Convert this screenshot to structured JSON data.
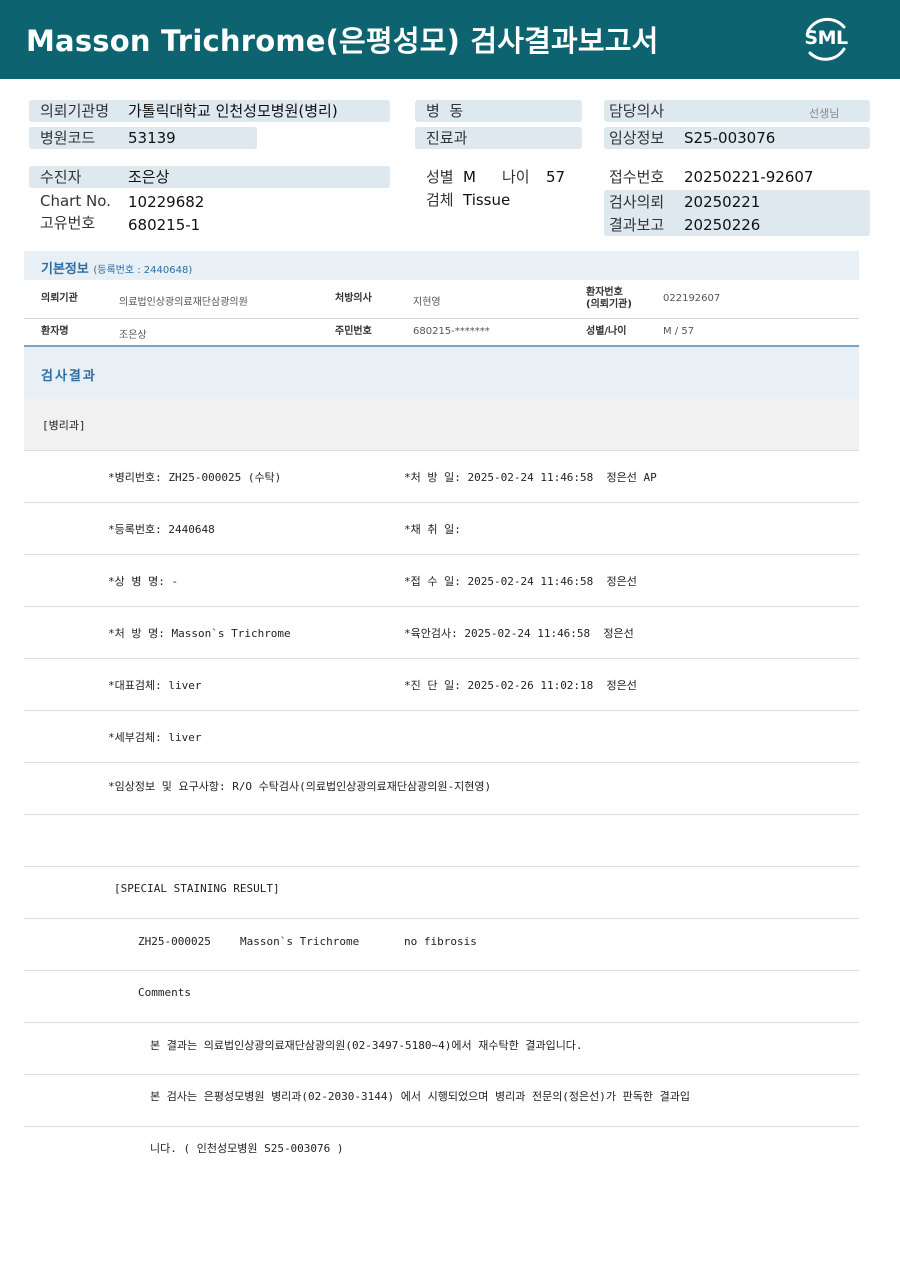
{
  "header": {
    "title": "Masson  Trichrome(은평성모) 검사결과보고서",
    "logo": "SML"
  },
  "top": {
    "req_org_label": "의뢰기관명",
    "req_org": "가톨릭대학교 인천성모병원(병리)",
    "hosp_code_label": "병원코드",
    "hosp_code": "53139",
    "ward_label": "병  동",
    "dept_label": "진료과",
    "doctor_label": "담당의사",
    "doctor_suffix": "선생님",
    "clinical_label": "임상정보",
    "clinical": "S25-003076",
    "patient_label": "수진자",
    "patient": "조은상",
    "chart_label": "Chart No.",
    "chart": "10229682",
    "unique_label": "고유번호",
    "unique": "680215-1",
    "sex_label": "성별",
    "sex": "M",
    "age_label": "나이",
    "age": "57",
    "specimen_label": "검체",
    "specimen": "Tissue",
    "receipt_label": "접수번호",
    "receipt": "20250221-92607",
    "request_label": "검사의뢰",
    "request": "20250221",
    "report_label": "결과보고",
    "report": "20250226"
  },
  "basic": {
    "title": "기본정보",
    "reg_note": "(등록번호 : 2440648)",
    "org_label": "의뢰기관",
    "org": "의료법인상광의료재단삼광의원",
    "presc_label": "처방의사",
    "presc": "지현영",
    "pno_label_1": "환자번호",
    "pno_label_2": "(의뢰기관)",
    "pno": "022192607",
    "name_label": "환자명",
    "name": "조은상",
    "rrn_label": "주민번호",
    "rrn": "680215-*******",
    "sexage_label": "성별/나이",
    "sexage": "M / 57"
  },
  "results": {
    "title": "검사결과",
    "dept": "[병리과]",
    "rows": [
      {
        "left": "*병리번호: ZH25-000025 (수탁)",
        "right": "*처 방 일: 2025-02-24 11:46:58  정은선 AP"
      },
      {
        "left": "*등록번호: 2440648",
        "right": "*채 취 일:"
      },
      {
        "left": "*상 병 명: -",
        "right": "*접 수 일: 2025-02-24 11:46:58  정은선"
      },
      {
        "left": "*처 방 명: Masson`s Trichrome",
        "right": "*육안검사: 2025-02-24 11:46:58  정은선"
      },
      {
        "left": "*대표검체: liver",
        "right": "*진 단 일: 2025-02-26 11:02:18  정은선"
      },
      {
        "left": "*세부검체: liver",
        "right": ""
      },
      {
        "left": "*임상정보 및 요구사항: R/O 수탁검사(의료법인상광의료재단삼광의원-지현영)",
        "right": ""
      }
    ],
    "special_title": "[SPECIAL STAINING RESULT]",
    "special_id": "ZH25-000025",
    "special_test": "Masson`s Trichrome",
    "special_result": "no fibrosis",
    "comments_label": "Comments",
    "comment1": "본 결과는 의료법인상광의료재단삼광의원(02-3497-5180~4)에서 재수탁한 결과입니다.",
    "comment2": "본 검사는 은평성모병원 병리과(02-2030-3144) 에서 시행되었으며 병리과 전문의(정은선)가 판독한 결과입",
    "comment3": "니다. ( 인천성모병원 S25-003076 )"
  }
}
